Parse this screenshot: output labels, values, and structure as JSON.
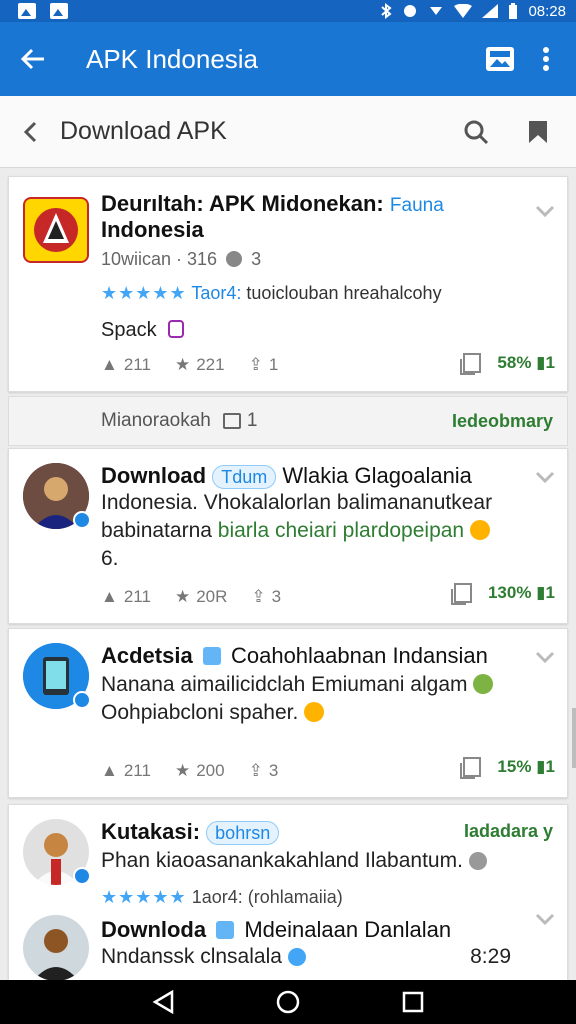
{
  "status_bar": {
    "time": "08:28"
  },
  "app_bar": {
    "title": "APK Indonesia"
  },
  "sub_bar": {
    "title": "Download APK"
  },
  "posts": [
    {
      "title": "Deurıltah: APK Midonekan:",
      "title_tag": "Fauna",
      "title_line2": "Indonesia",
      "meta": "10wiican · 316",
      "meta_count": "3",
      "stars": "★★★★★",
      "rating_tag": "Taor4:",
      "rating_text": "tuoiclouban hreahalcohy",
      "extra": "Spack",
      "likes": "211",
      "favs": "221",
      "shares": "1",
      "percent": "58%",
      "percent_count": "1"
    },
    {
      "title": "Download",
      "title_tag": "Tdum",
      "title_rest": "Wlakia Glagoalania",
      "line2": "Indonesia. Vhokalalorlan balimananutkear",
      "line3_a": "babinatarna",
      "line3_b": "biarla cheiari plardopeipan",
      "line4": "6.",
      "likes": "211",
      "favs": "20R",
      "shares": "3",
      "percent": "130%",
      "percent_count": "1"
    },
    {
      "title": "Acdetsia",
      "title_rest": "Coahohlaabnan Indansian",
      "line2": "Nanana aimailicidclah Emiumani algam",
      "line3": "Oohpiabcloni spaher.",
      "likes": "211",
      "favs": "200",
      "shares": "3",
      "percent": "15%",
      "percent_count": "1"
    },
    {
      "title": "Kutakasi:",
      "title_tag": "bohrsn",
      "right_tag": "Iadadara y",
      "line2": "Phan kiaoasanankakahland Ilabantum.",
      "stars": "★★★★★",
      "rating_text": "1aor4: (rohlamaiia)",
      "title2": "Downloda",
      "title2_rest": "Mdeinalaan Danlalan",
      "line3": "Nndanssk clnsalala",
      "time": "8:29"
    }
  ],
  "divider": {
    "label": "Mianoraokah",
    "count": "1",
    "right": "Iedeobmary"
  },
  "colors": {
    "primary": "#1976d2",
    "status": "#1565c0",
    "accent": "#1e88e5",
    "green": "#2e7d32"
  }
}
